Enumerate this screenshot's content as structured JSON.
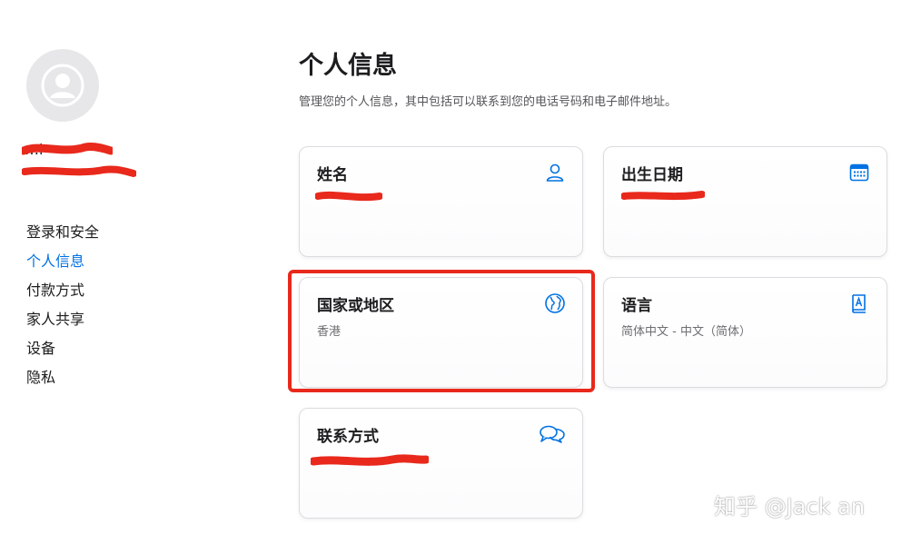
{
  "sidebar": {
    "user_name": "…i",
    "user_email": "…",
    "nav_items": [
      {
        "label": "登录和安全",
        "active": false
      },
      {
        "label": "个人信息",
        "active": true
      },
      {
        "label": "付款方式",
        "active": false
      },
      {
        "label": "家人共享",
        "active": false
      },
      {
        "label": "设备",
        "active": false
      },
      {
        "label": "隐私",
        "active": false
      }
    ]
  },
  "main": {
    "title": "个人信息",
    "description": "管理您的个人信息，其中包括可以联系到您的电话号码和电子邮件地址。",
    "cards": [
      {
        "title": "姓名",
        "value": "",
        "icon": "person-icon"
      },
      {
        "title": "出生日期",
        "value": "",
        "icon": "calendar-icon"
      },
      {
        "title": "国家或地区",
        "value": "香港",
        "icon": "globe-icon"
      },
      {
        "title": "语言",
        "value": "简体中文 - 中文（简体）",
        "icon": "language-book-icon"
      },
      {
        "title": "联系方式",
        "value": "",
        "icon": "chat-bubbles-icon"
      }
    ]
  },
  "watermark": "知乎 @Jack an",
  "colors": {
    "accent": "#0071e3",
    "annotation_red": "#e8291c",
    "card_border": "#dcdce0"
  }
}
